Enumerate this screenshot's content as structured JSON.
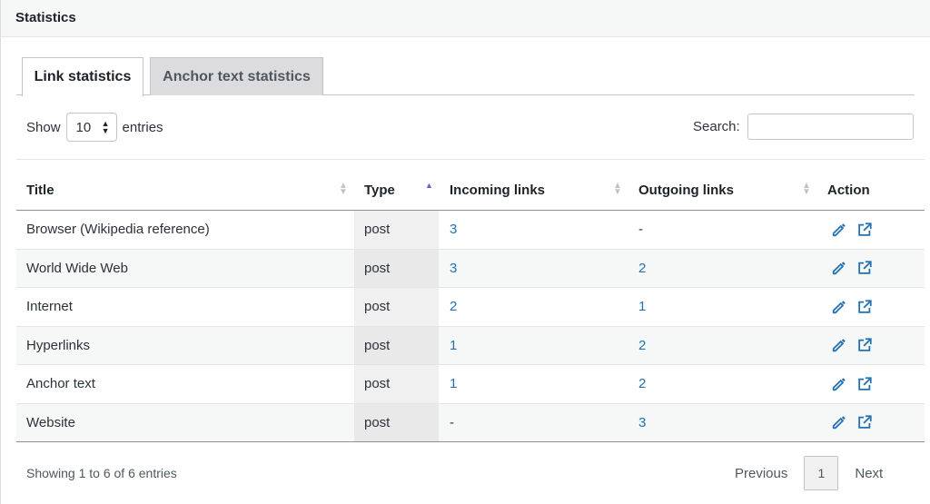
{
  "panel": {
    "title": "Statistics"
  },
  "tabs": [
    {
      "label": "Link statistics",
      "active": true
    },
    {
      "label": "Anchor text statistics",
      "active": false
    }
  ],
  "length_control": {
    "prefix": "Show",
    "value": "10",
    "suffix": "entries"
  },
  "search": {
    "label": "Search:",
    "value": "",
    "placeholder": ""
  },
  "columns": {
    "title": "Title",
    "type": "Type",
    "incoming": "Incoming links",
    "outgoing": "Outgoing links",
    "action": "Action"
  },
  "rows": [
    {
      "title": "Browser (Wikipedia reference)",
      "type": "post",
      "incoming": "3",
      "outgoing": "-"
    },
    {
      "title": "World Wide Web",
      "type": "post",
      "incoming": "3",
      "outgoing": "2"
    },
    {
      "title": "Internet",
      "type": "post",
      "incoming": "2",
      "outgoing": "1"
    },
    {
      "title": "Hyperlinks",
      "type": "post",
      "incoming": "1",
      "outgoing": "2"
    },
    {
      "title": "Anchor text",
      "type": "post",
      "incoming": "1",
      "outgoing": "2"
    },
    {
      "title": "Website",
      "type": "post",
      "incoming": "-",
      "outgoing": "3"
    }
  ],
  "row_actions": [
    "edit-icon",
    "external-link-icon"
  ],
  "footer": {
    "info": "Showing 1 to 6 of 6 entries",
    "previous": "Previous",
    "current_page": "1",
    "next": "Next"
  },
  "colors": {
    "link": "#2271b1",
    "sort_active": "#5b65c8"
  }
}
